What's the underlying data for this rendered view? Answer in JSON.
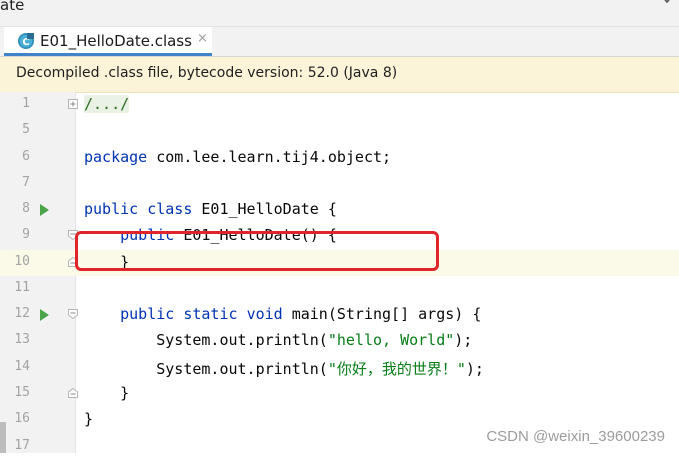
{
  "window": {
    "title_fragment": "ate"
  },
  "tab": {
    "label": "E01_HelloDate.class",
    "close_glyph": "×",
    "file_icon": "class-file-icon"
  },
  "banner": {
    "text": "Decompiled .class file, bytecode version: 52.0 (Java 8)"
  },
  "editor": {
    "current_line": "10",
    "lines": [
      {
        "num": "1",
        "kind": "fold",
        "text": "/.../"
      },
      {
        "num": "5",
        "text": ""
      },
      {
        "num": "6",
        "kw1": "package",
        "rest": " com.lee.learn.tij4.object;"
      },
      {
        "num": "7",
        "text": ""
      },
      {
        "num": "8",
        "kw1": "public",
        "kw2": "class",
        "rest": " E01_HelloDate {"
      },
      {
        "num": "9",
        "indent": "    ",
        "kw1": "public",
        "rest": " E01_HelloDate() {"
      },
      {
        "num": "10",
        "text": "    }"
      },
      {
        "num": "11",
        "text": ""
      },
      {
        "num": "12",
        "indent": "    ",
        "kw1": "public",
        "kw2": "static",
        "kw3": "void",
        "rest": " main(String[] args) {"
      },
      {
        "num": "13",
        "pre": "        System.out.println(",
        "str": "\"hello, World\"",
        "post": ");"
      },
      {
        "num": "14",
        "pre": "        System.out.println(",
        "str": "\"你好，我的世界！\"",
        "post": ");"
      },
      {
        "num": "15",
        "text": "    }"
      },
      {
        "num": "16",
        "text": "}"
      },
      {
        "num": "17",
        "text": ""
      }
    ]
  },
  "watermark": "CSDN @weixin_39600239",
  "colors": {
    "keyword": "#0033b3",
    "string": "#067d17",
    "highlight_box": "#e0242a",
    "run_icon": "#4aa54a"
  }
}
